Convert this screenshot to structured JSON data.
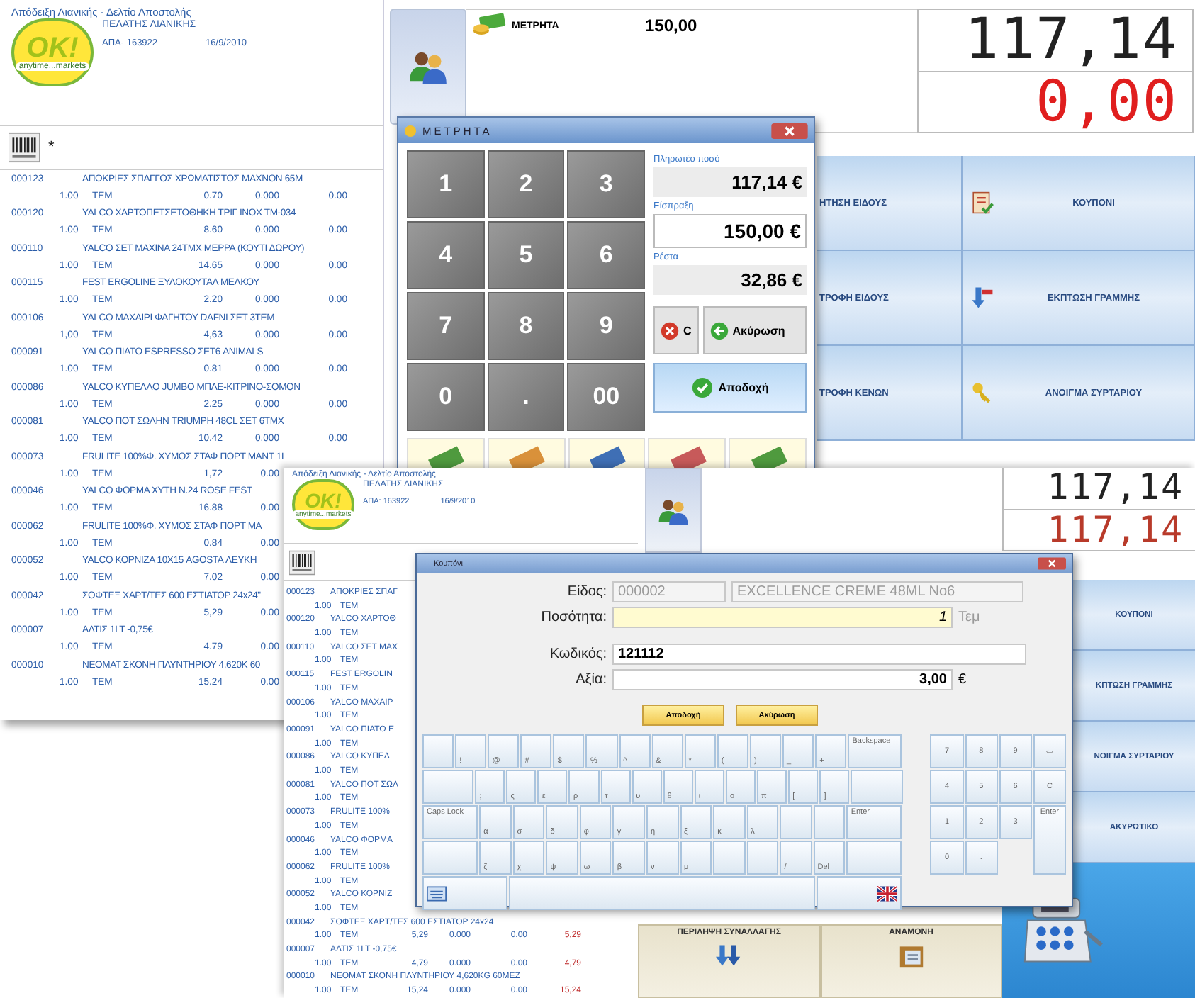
{
  "back_screen": {
    "receipt_title": "Απόδειξη Λιανικής - Δελτίο Αποστολής",
    "logo": {
      "mark": "OK!",
      "tagline": "anytime...markets"
    },
    "customer": "ΠΕΛΑΤΗΣ ΛΙΑΝΙΚΗΣ",
    "afm": "ΑΠΑ- 163922",
    "date": "16/9/2010",
    "scan_value": "*",
    "items": [
      {
        "code": "000123",
        "name": "ΑΠΟΚΡΙΕΣ ΣΠΑΓΓΟΣ ΧΡΩΜΑΤΙΣΤΟΣ ΜΑΧΝΟΝ 65M",
        "qty": "1.00",
        "unit": "ΤΕΜ",
        "price": "0.70",
        "discount": "0.000",
        "total": "0.00"
      },
      {
        "code": "000120",
        "name": "YALCO ΧΑΡΤΟΠΕΤΣΕΤΟΘΗΚΗ ΤΡΙΓ ΙΝΟΧ ΤΜ-034",
        "qty": "1.00",
        "unit": "ΤΕΜ",
        "price": "8.60",
        "discount": "0.000",
        "total": "0.00"
      },
      {
        "code": "000110",
        "name": "YALCO ΣΕΤ ΜΑΧΙΝΑ 24ΤΜΧ ΜΕΡΡΑ (ΚΟΥΤΙ ΔΩΡΟΥ)",
        "qty": "1.00",
        "unit": "ΤΕΜ",
        "price": "14.65",
        "discount": "0.000",
        "total": "0.00"
      },
      {
        "code": "000115",
        "name": "FEST ERGOLINE ΞΥΛΟΚΟΥΤΑΛ ΜΕΛΚΟΥ",
        "qty": "1.00",
        "unit": "ΤΕΜ",
        "price": "2.20",
        "discount": "0.000",
        "total": "0.00"
      },
      {
        "code": "000106",
        "name": "YALCO ΜΑΧΑΙΡΙ ΦΑΓΗΤΟΥ DAFNI ΣΕΤ 3ΤΕΜ",
        "qty": "1,00",
        "unit": "ΤΕΜ",
        "price": "4,63",
        "discount": "0.000",
        "total": "0.00"
      },
      {
        "code": "000091",
        "name": "YALCO ΠΙΑΤΟ ESPRESSO ΣΕΤ6 ANIMALS",
        "qty": "1.00",
        "unit": "ΤΕΜ",
        "price": "0.81",
        "discount": "0.000",
        "total": "0.00"
      },
      {
        "code": "000086",
        "name": "YALCO ΚΥΠΕΛΛΟ JUMBO ΜΠΛΕ-ΚΙΤΡΙΝΟ-ΣΟΜΟΝ",
        "qty": "1.00",
        "unit": "ΤΕΜ",
        "price": "2.25",
        "discount": "0.000",
        "total": "0.00"
      },
      {
        "code": "000081",
        "name": "YALCO ΠΟΤ ΣΩΛΗΝ TRIUMPH 48CL ΣΕΤ 6ΤΜΧ",
        "qty": "1.00",
        "unit": "ΤΕΜ",
        "price": "10.42",
        "discount": "0.000",
        "total": "0.00"
      },
      {
        "code": "000073",
        "name": "FRULITE 100%Φ. ΧΥΜΟΣ ΣΤΑΦ ΠΟΡΤ ΜΑΝΤ 1L",
        "qty": "1.00",
        "unit": "ΤΕΜ",
        "price": "1,72",
        "discount": "0.00"
      },
      {
        "code": "000046",
        "name": "YALCO ΦΟΡΜΑ ΧΥΤΗ Ν.24 ROSE FEST",
        "qty": "1.00",
        "unit": "ΤΕΜ",
        "price": "16.88",
        "discount": "0.00"
      },
      {
        "code": "000062",
        "name": "FRULITE 100%Φ. ΧΥΜΟΣ ΣΤΑΦ ΠΟΡΤ ΜΑ",
        "qty": "1.00",
        "unit": "ΤΕΜ",
        "price": "0.84",
        "discount": "0.00"
      },
      {
        "code": "000052",
        "name": "YALCO ΚΟΡΝΙΖΑ 10Χ15 AGOSTA ΛΕΥΚΗ",
        "qty": "1.00",
        "unit": "ΤΕΜ",
        "price": "7.02",
        "discount": "0.00"
      },
      {
        "code": "000042",
        "name": "ΣΟΦΤΕΞ ΧΑΡΤ/ΤΕΣ 600 ΕΣΤΙΑΤΟΡ 24x24\"",
        "qty": "1.00",
        "unit": "ΤΕΜ",
        "price": "5,29",
        "discount": "0.00"
      },
      {
        "code": "000007",
        "name": "ΑΛΤΙΣ 1LT -0,75€",
        "qty": "1.00",
        "unit": "ΤΕΜ",
        "price": "4.79",
        "discount": "0.00"
      },
      {
        "code": "000010",
        "name": "ΝΕΟΜΑΤ ΣΚΟΝΗ ΠΛΥΝΤΗΡΙΟΥ 4,620K 60",
        "qty": "1.00",
        "unit": "ΤΕΜ",
        "price": "15.24",
        "discount": "0.00"
      }
    ],
    "payment": {
      "method": "ΜΕΤΡΗΤΑ",
      "amount": "150,00"
    },
    "display": {
      "total": "117,14",
      "change": "0,00"
    },
    "functions": [
      {
        "left": "ΗΤΗΣΗ ΕΙΔΟΥΣ",
        "right": "ΚΟΥΠΟΝΙ",
        "kind": "coupon"
      },
      {
        "left": "ΤΡΟΦΗ ΕΙΔΟΥΣ",
        "right": "ΕΚΠΤΩΣΗ ΓΡΑΜΜΗΣ",
        "kind": "discount"
      },
      {
        "left": "ΤΡΟΦΗ ΚΕΝΩΝ",
        "right": "ΑΝΟΙΓΜΑ ΣΥΡΤΑΡΙΟΥ",
        "kind": "drawer"
      }
    ]
  },
  "cash_dialog": {
    "title": "ΜΕΤΡΗΤΑ",
    "keys": [
      "1",
      "2",
      "3",
      "4",
      "5",
      "6",
      "7",
      "8",
      "9",
      "0",
      ".",
      "00"
    ],
    "due_label": "Πληρωτέο ποσό",
    "due": "117,14 €",
    "received_label": "Είσπραξη",
    "received": "150,00 €",
    "change_label": "Ρέστα",
    "change": "32,86 €",
    "clear": "C",
    "cancel": "Ακύρωση",
    "accept": "Αποδοχή",
    "banknotes": [
      {
        "color": "#4f9a3e"
      },
      {
        "color": "#d9913a"
      },
      {
        "color": "#3f6fb5"
      },
      {
        "color": "#c75a5a"
      },
      {
        "color": "#4f9a3e"
      }
    ]
  },
  "front_screen": {
    "receipt_title": "Απόδειξη Λιανικής - Δελτίο Αποστολής",
    "logo": {
      "mark": "OK!",
      "tagline": "anytime...markets"
    },
    "customer": "ΠΕΛΑΤΗΣ ΛΙΑΝΙΚΗΣ",
    "afm": "ΑΠΑ: 163922",
    "date": "16/9/2010",
    "items": [
      {
        "code": "000123",
        "name": "ΑΠΟΚΡΙΕΣ ΣΠΑΓ",
        "qty": "1.00",
        "unit": "ΤΕΜ"
      },
      {
        "code": "000120",
        "name": "YALCO ΧΑΡΤΟΘ",
        "qty": "1.00",
        "unit": "ΤΕΜ"
      },
      {
        "code": "000110",
        "name": "YALCO ΣΕΤ ΜΑΧ",
        "qty": "1.00",
        "unit": "ΤΕΜ"
      },
      {
        "code": "000115",
        "name": "FEST ERGOLIN",
        "qty": "1.00",
        "unit": "ΤΕΜ"
      },
      {
        "code": "000106",
        "name": "YALCO ΜΑΧΑΙΡ",
        "qty": "1.00",
        "unit": "ΤΕΜ"
      },
      {
        "code": "000091",
        "name": "YALCO ΠΙΑΤΟ Ε",
        "qty": "1.00",
        "unit": "ΤΕΜ"
      },
      {
        "code": "000086",
        "name": "YALCO ΚΥΠΕΛ",
        "qty": "1.00",
        "unit": "ΤΕΜ"
      },
      {
        "code": "000081",
        "name": "YALCO ΠΟΤ ΣΩΛ",
        "qty": "1.00",
        "unit": "ΤΕΜ"
      },
      {
        "code": "000073",
        "name": "FRULITE 100%",
        "qty": "1.00",
        "unit": "ΤΕΜ"
      },
      {
        "code": "000046",
        "name": "YALCO ΦΟΡΜΑ",
        "qty": "1.00",
        "unit": "ΤΕΜ"
      },
      {
        "code": "000062",
        "name": "FRULITE 100%",
        "qty": "1.00",
        "unit": "ΤΕΜ"
      },
      {
        "code": "000052",
        "name": "YALCO ΚΟΡΝΙΖ",
        "qty": "1.00",
        "unit": "ΤΕΜ"
      },
      {
        "code": "000042",
        "name": "ΣΟΦΤΕΞ ΧΑΡΤ/ΤΕΣ 600 ΕΣΤΙΑΤΟΡ 24x24",
        "qty": "1.00",
        "unit": "ΤΕΜ",
        "price": "5,29",
        "discount": "0.000",
        "vat": "0.00",
        "total": "5,29"
      },
      {
        "code": "000007",
        "name": "ΑΛΤΙΣ 1LT -0,75€",
        "qty": "1.00",
        "unit": "ΤΕΜ",
        "price": "4,79",
        "discount": "0.000",
        "vat": "0.00",
        "total": "4,79"
      },
      {
        "code": "000010",
        "name": "ΝΕΟΜΑΤ ΣΚΟΝΗ ΠΛΥΝΤΗΡΙΟΥ 4,620KG 60ΜΕΖ",
        "qty": "1.00",
        "unit": "ΤΕΜ",
        "price": "15,24",
        "discount": "0.000",
        "vat": "0.00",
        "total": "15,24"
      }
    ],
    "display": {
      "total": "117,14",
      "paid": "117,14"
    },
    "functions": [
      "ΚΟΥΠΟΝΙ",
      "ΚΠΤΩΣΗ ΓΡΑΜΜΗΣ",
      "ΝΟΙΓΜΑ ΣΥΡΤΑΡΙΟΥ",
      "ΑΚΥΡΩΤΙΚΟ"
    ],
    "bottom_buttons": [
      {
        "label": "ΠΕΡΙΛΗΨΗ ΣΥΝΑΛΛΑΓΗΣ",
        "kind": "summary"
      },
      {
        "label": "ΑΝΑΜΟΝΗ",
        "kind": "hold"
      }
    ]
  },
  "coupon_dialog": {
    "title": "Κουπόνι",
    "item_label": "Είδος:",
    "item_code": "000002",
    "item_name": "EXCELLENCE CREME 48ML  No6",
    "qty_label": "Ποσότητα:",
    "qty": "1",
    "qty_unit": "Τεμ",
    "code_label": "Κωδικός:",
    "code": "121112",
    "value_label": "Αξία:",
    "value": "3,00",
    "currency": "€",
    "accept": "Αποδοχή",
    "cancel": "Ακύρωση",
    "keyboard": [
      [
        {
          "kind": "key"
        },
        {
          "kind": "key",
          "label": "!"
        },
        {
          "kind": "key",
          "label": "@"
        },
        {
          "kind": "key",
          "label": "#"
        },
        {
          "kind": "key",
          "label": "$"
        },
        {
          "kind": "key",
          "label": "%"
        },
        {
          "kind": "key",
          "label": "^"
        },
        {
          "kind": "key",
          "label": "&"
        },
        {
          "kind": "key",
          "label": "*"
        },
        {
          "kind": "key",
          "label": "("
        },
        {
          "kind": "key",
          "label": ")"
        },
        {
          "kind": "key",
          "label": "_"
        },
        {
          "kind": "key",
          "label": "+"
        },
        {
          "kind": "wide",
          "label": "Backspace"
        }
      ],
      [
        {
          "kind": "wide"
        },
        {
          "kind": "key",
          "label": ";"
        },
        {
          "kind": "key",
          "label": "ς"
        },
        {
          "kind": "key",
          "label": "ε"
        },
        {
          "kind": "key",
          "label": "ρ"
        },
        {
          "kind": "key",
          "label": "τ"
        },
        {
          "kind": "key",
          "label": "υ"
        },
        {
          "kind": "key",
          "label": "θ"
        },
        {
          "kind": "key",
          "label": "ι"
        },
        {
          "kind": "key",
          "label": "ο"
        },
        {
          "kind": "key",
          "label": "π"
        },
        {
          "kind": "key",
          "label": "["
        },
        {
          "kind": "key",
          "label": "]"
        },
        {
          "kind": "wide"
        }
      ],
      [
        {
          "kind": "wide",
          "label": "Caps Lock"
        },
        {
          "kind": "key",
          "label": "α"
        },
        {
          "kind": "key",
          "label": "σ"
        },
        {
          "kind": "key",
          "label": "δ"
        },
        {
          "kind": "key",
          "label": "φ"
        },
        {
          "kind": "key",
          "label": "γ"
        },
        {
          "kind": "key",
          "label": "η"
        },
        {
          "kind": "key",
          "label": "ξ"
        },
        {
          "kind": "key",
          "label": "κ"
        },
        {
          "kind": "key",
          "label": "λ"
        },
        {
          "kind": "key"
        },
        {
          "kind": "key"
        },
        {
          "kind": "wide",
          "label": "Enter"
        }
      ],
      [
        {
          "kind": "wide"
        },
        {
          "kind": "key",
          "label": "ζ"
        },
        {
          "kind": "key",
          "label": "χ"
        },
        {
          "kind": "key",
          "label": "ψ"
        },
        {
          "kind": "key",
          "label": "ω"
        },
        {
          "kind": "key",
          "label": "β"
        },
        {
          "kind": "key",
          "label": "ν"
        },
        {
          "kind": "key",
          "label": "μ"
        },
        {
          "kind": "key"
        },
        {
          "kind": "key"
        },
        {
          "kind": "key",
          "label": "/"
        },
        {
          "kind": "key",
          "label": "Del"
        },
        {
          "kind": "wide"
        }
      ],
      [
        {
          "kind": "keyboard"
        },
        {
          "kind": "space"
        },
        {
          "kind": "flag"
        }
      ]
    ],
    "numpad": [
      [
        {
          "label": "7"
        },
        {
          "label": "8"
        },
        {
          "label": "9"
        },
        {
          "label": "⇦"
        }
      ],
      [
        {
          "label": "4"
        },
        {
          "label": "5"
        },
        {
          "label": "6"
        },
        {
          "label": "C"
        }
      ],
      [
        {
          "label": "1"
        },
        {
          "label": "2"
        },
        {
          "label": "3"
        },
        {
          "label": "Enter"
        }
      ],
      [
        {
          "label": "0"
        },
        {
          "label": "."
        }
      ]
    ]
  }
}
